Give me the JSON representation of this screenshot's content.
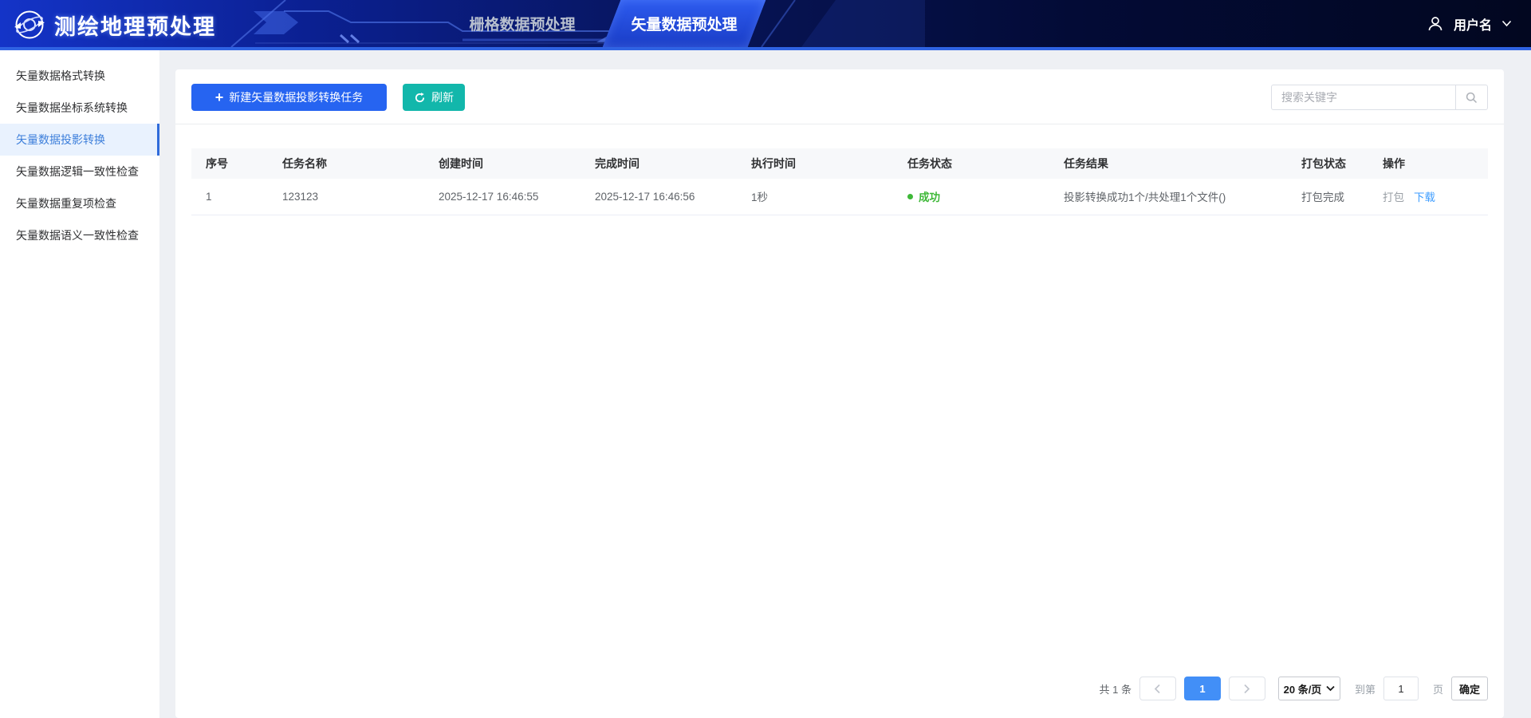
{
  "header": {
    "logo_title": "测绘地理预处理",
    "tabs": [
      {
        "label": "栅格数据预处理",
        "active": false
      },
      {
        "label": "矢量数据预处理",
        "active": true
      }
    ],
    "user": {
      "name": "用户名"
    }
  },
  "sidebar": {
    "items": [
      {
        "label": "矢量数据格式转换",
        "active": false
      },
      {
        "label": "矢量数据坐标系统转换",
        "active": false
      },
      {
        "label": "矢量数据投影转换",
        "active": true
      },
      {
        "label": "矢量数据逻辑一致性检查",
        "active": false
      },
      {
        "label": "矢量数据重复项检查",
        "active": false
      },
      {
        "label": "矢量数据语义一致性检查",
        "active": false
      }
    ]
  },
  "toolbar": {
    "new_task_icon": "+",
    "new_task_label": "新建矢量数据投影转换任务",
    "refresh_label": "刷新",
    "search_placeholder": "搜索关键字"
  },
  "table": {
    "columns": [
      "序号",
      "任务名称",
      "创建时间",
      "完成时间",
      "执行时间",
      "任务状态",
      "任务结果",
      "打包状态",
      "操作"
    ],
    "rows": [
      {
        "index": "1",
        "name": "123123",
        "created": "2025-12-17 16:46:55",
        "finished": "2025-12-17 16:46:56",
        "duration": "1秒",
        "status": "成功",
        "result": "投影转换成功1个/共处理1个文件()",
        "package_status": "打包完成",
        "action_package": "打包",
        "action_download": "下载"
      }
    ]
  },
  "pagination": {
    "total": "共 1 条",
    "current_page": "1",
    "page_size": "20 条/页",
    "goto_prefix": "到第",
    "goto_value": "1",
    "goto_suffix": "页",
    "confirm": "确定"
  },
  "icons": {
    "logo": "globe-orbit-icon",
    "new_task": "plus-icon",
    "refresh": "refresh-icon",
    "search": "search-icon",
    "user": "user-icon",
    "user_caret": "chevron-down-icon",
    "prev": "chevron-left-icon",
    "next": "chevron-right-icon",
    "select_caret": "chevron-down-icon",
    "status": "status-dot-icon"
  },
  "colors": {
    "accent_blue": "#2664f1",
    "teal": "#12b7ab",
    "success_green": "#3eb838",
    "link_blue": "#409eff",
    "header_line": "#2f63e3",
    "menu_active_bg": "#e9f2fe",
    "menu_active_text": "#3d7fdb",
    "menu_active_bar": "#2f6bdb",
    "pagination_active": "#428ff7"
  }
}
